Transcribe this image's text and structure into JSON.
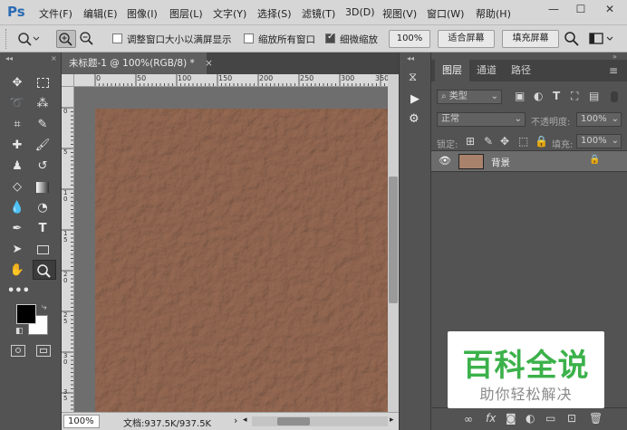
{
  "app": {
    "logo": "Ps",
    "menus": [
      "文件(F)",
      "编辑(E)",
      "图像(I)",
      "图层(L)",
      "文字(Y)",
      "选择(S)",
      "滤镜(T)",
      "3D(D)",
      "视图(V)",
      "窗口(W)",
      "帮助(H)"
    ],
    "window_controls": {
      "minimize": "—",
      "maximize": "☐",
      "close": "✕"
    }
  },
  "options_bar": {
    "resize_windows_label": "调整窗口大小以满屏显示",
    "resize_windows_checked": false,
    "zoom_all_label": "缩放所有窗口",
    "zoom_all_checked": false,
    "scrubby_zoom_label": "细微缩放",
    "scrubby_zoom_checked": true,
    "btn_100": "100%",
    "btn_fit": "适合屏幕",
    "btn_fill": "填充屏幕"
  },
  "document": {
    "tab_title": "未标题-1 @ 100%(RGB/8) *",
    "tab_close": "×",
    "ruler_top_ticks": [
      "0",
      "50",
      "100",
      "150",
      "200",
      "250",
      "300",
      "350"
    ],
    "ruler_left_ticks": [
      "0",
      "5",
      "1 0",
      "1 5",
      "2 0",
      "2 5",
      "3 0",
      "3 5"
    ],
    "zoom": "100%",
    "doc_size": "文档:937.5K/937.5K",
    "canvas_color": "#a9826c"
  },
  "layers_panel": {
    "tabs": [
      "图层",
      "通道",
      "路径"
    ],
    "filter_kind": "类型",
    "blend_mode": "正常",
    "opacity_label": "不透明度:",
    "opacity_value": "100%",
    "lock_label": "锁定:",
    "fill_label": "填充:",
    "fill_value": "100%",
    "layers": [
      {
        "name": "背景",
        "visible": true,
        "locked": true
      }
    ]
  },
  "watermark": {
    "title": "百科全说",
    "subtitle": "助你轻松解决"
  },
  "colors": {
    "foreground": "#000000",
    "background": "#ffffff"
  }
}
